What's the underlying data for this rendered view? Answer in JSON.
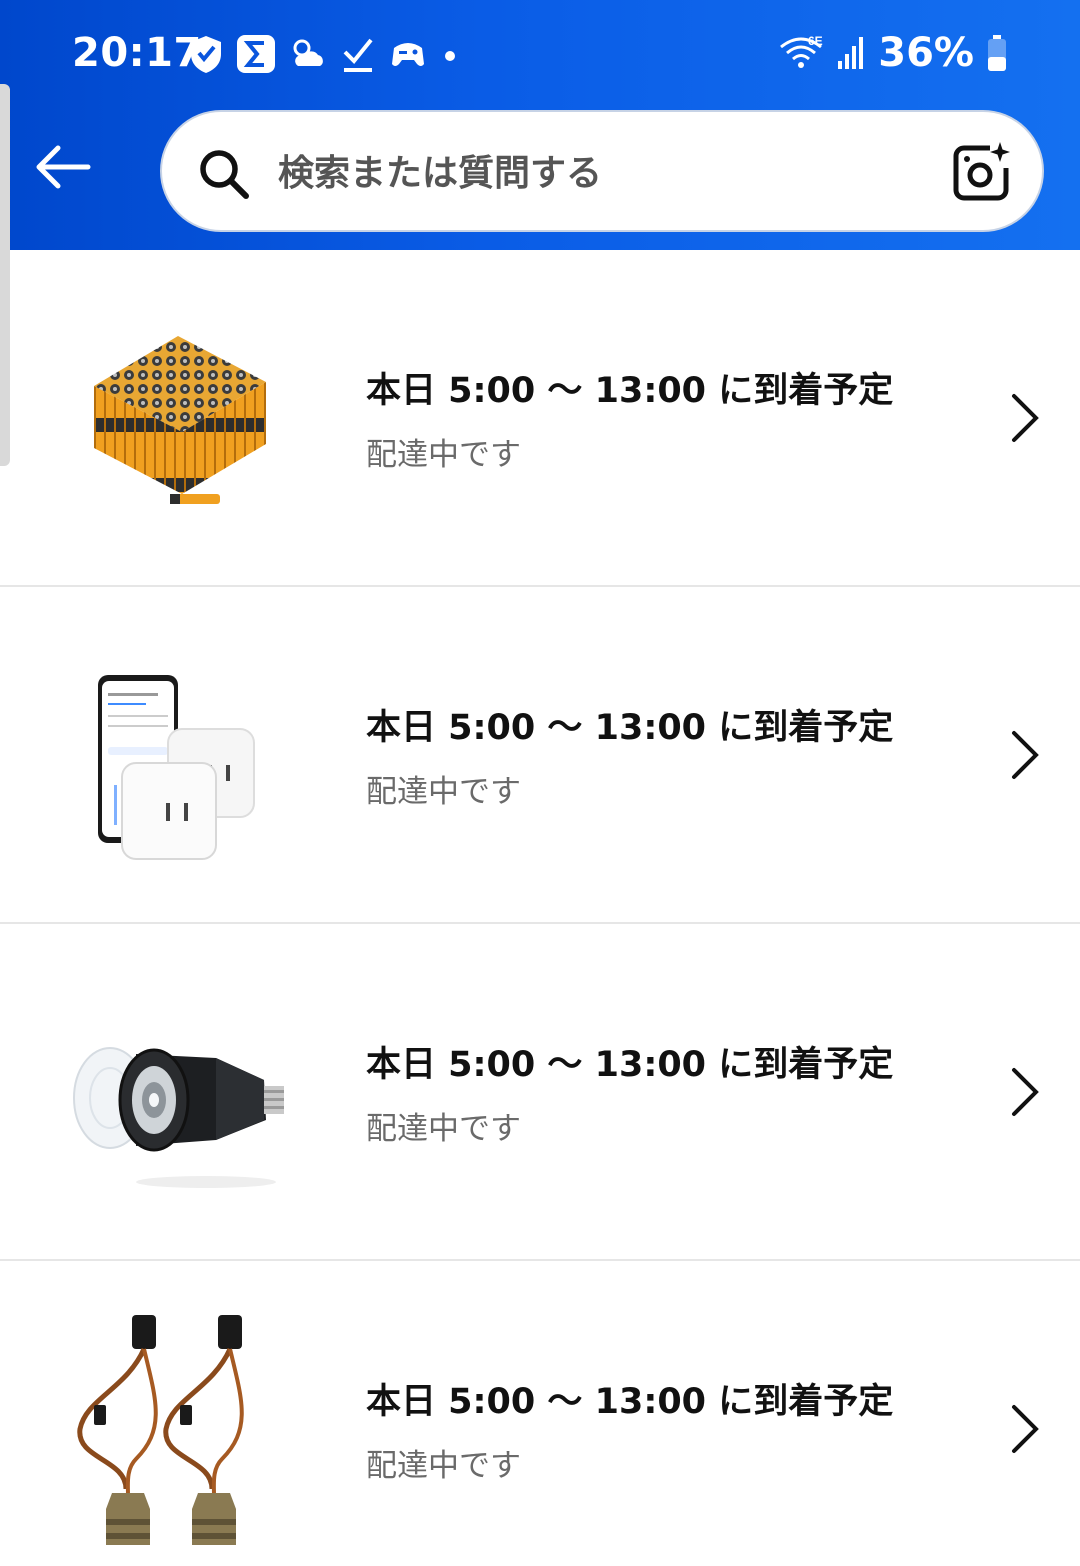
{
  "status_bar": {
    "time": "20:17",
    "battery": "36%",
    "network": "6E",
    "icons_left": [
      "shield-icon",
      "sigma-icon",
      "weather-icon",
      "check-icon",
      "game-icon",
      "dot-icon"
    ],
    "icons_right": [
      "wifi-icon",
      "signal-icon",
      "battery-icon"
    ]
  },
  "header": {
    "search_placeholder": "検索または質問する",
    "back_icon": "arrow-left-icon",
    "camera_icon": "camera-sparkle-icon",
    "colors": {
      "gradient_start": "#0047cc",
      "gradient_end": "#1470f0"
    }
  },
  "deliveries": [
    {
      "title": "本日 5:00 ～ 13:00 に到着予定",
      "status": "配達中です",
      "image": "batteries-image"
    },
    {
      "title": "本日 5:00 ～ 13:00 に到着予定",
      "status": "配達中です",
      "image": "smart-plug-image"
    },
    {
      "title": "本日 5:00 ～ 13:00 に到着予定",
      "status": "配達中です",
      "image": "led-bulb-image"
    },
    {
      "title": "本日 5:00 ～ 13:00 に到着予定",
      "status": "配達中です",
      "image": "pendant-socket-image"
    }
  ]
}
